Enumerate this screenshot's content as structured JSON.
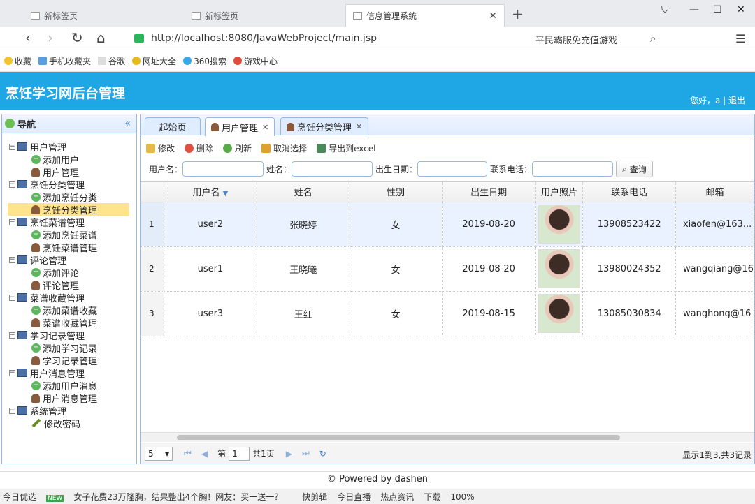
{
  "browser": {
    "tabs": [
      {
        "label": "新标签页"
      },
      {
        "label": "新标签页"
      },
      {
        "label": "信息管理系统"
      }
    ],
    "url": "http://localhost:8080/JavaWebProject/main.jsp",
    "search_text": "平民霸服免充值游戏",
    "favorites": [
      "收藏",
      "手机收藏夹",
      "谷歌",
      "网址大全",
      "360搜索",
      "游戏中心"
    ]
  },
  "app": {
    "title": "烹饪学习网后台管理",
    "welcome": "您好，a | 退出"
  },
  "sidebar": {
    "title": "导航",
    "groups": [
      {
        "label": "用户管理",
        "children": [
          "添加用户",
          "用户管理"
        ]
      },
      {
        "label": "烹饪分类管理",
        "children": [
          "添加烹饪分类",
          "烹饪分类管理"
        ]
      },
      {
        "label": "烹饪菜谱管理",
        "children": [
          "添加烹饪菜谱",
          "烹饪菜谱管理"
        ]
      },
      {
        "label": "评论管理",
        "children": [
          "添加评论",
          "评论管理"
        ]
      },
      {
        "label": "菜谱收藏管理",
        "children": [
          "添加菜谱收藏",
          "菜谱收藏管理"
        ]
      },
      {
        "label": "学习记录管理",
        "children": [
          "添加学习记录",
          "学习记录管理"
        ]
      },
      {
        "label": "用户消息管理",
        "children": [
          "添加用户消息",
          "用户消息管理"
        ]
      },
      {
        "label": "系统管理",
        "children": [
          "修改密码"
        ]
      }
    ]
  },
  "panel_tabs": [
    "起始页",
    "用户管理",
    "烹饪分类管理"
  ],
  "toolbar": [
    "修改",
    "删除",
    "刷新",
    "取消选择",
    "导出到excel"
  ],
  "filters": {
    "username": "用户名：",
    "name": "姓名：",
    "birth": "出生日期：",
    "phone": "联系电话：",
    "query": "查询"
  },
  "table": {
    "columns": [
      "用户名",
      "姓名",
      "性别",
      "出生日期",
      "用户照片",
      "联系电话",
      "邮箱"
    ],
    "rows": [
      {
        "n": "1",
        "user": "user2",
        "name": "张晓婷",
        "sex": "女",
        "birth": "2019-08-20",
        "phone": "13908523422",
        "email": "xiaofen@163..."
      },
      {
        "n": "2",
        "user": "user1",
        "name": "王晓曦",
        "sex": "女",
        "birth": "2019-08-20",
        "phone": "13980024352",
        "email": "wangqiang@16"
      },
      {
        "n": "3",
        "user": "user3",
        "name": "王红",
        "sex": "女",
        "birth": "2019-08-15",
        "phone": "13085030834",
        "email": "wanghong@16"
      }
    ]
  },
  "pager": {
    "size": "5",
    "page_label": "第",
    "page": "1",
    "total_pages": "共1页",
    "info": "显示1到3,共3记录"
  },
  "footer": "© Powered by dashen",
  "status": [
    "今日优选",
    "女子花费23万隆胸，结果整出4个胸！网友：买一送一？",
    "快剪辑",
    "今日直播",
    "热点资讯",
    "下载",
    "100%"
  ]
}
